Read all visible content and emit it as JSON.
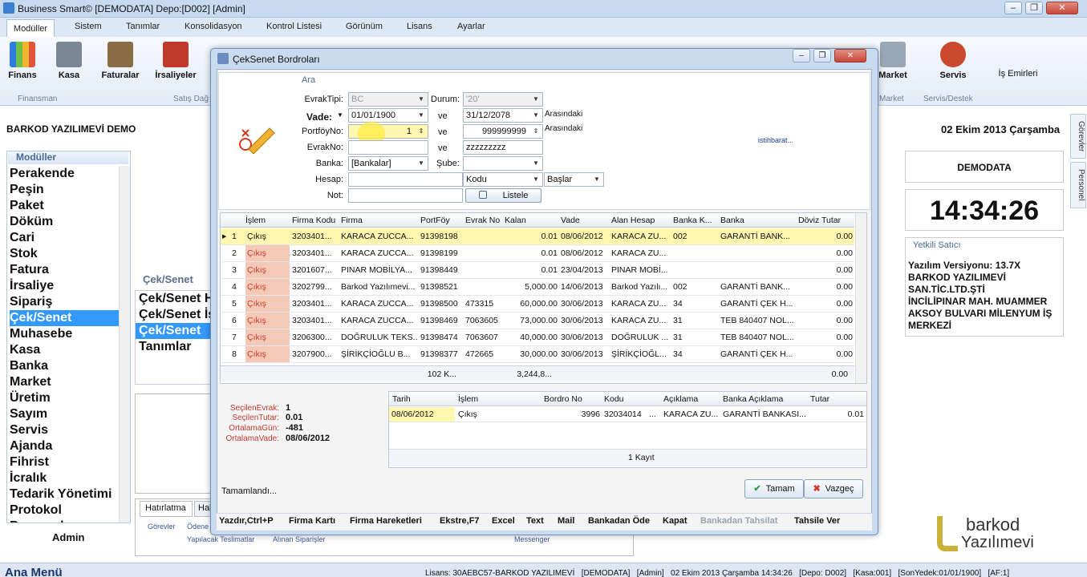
{
  "app": {
    "title": "Business Smart© [DEMODATA] Depo:[D002] [Admin]",
    "window_controls": {
      "minimize": "–",
      "restore": "❐",
      "close": "✕"
    }
  },
  "menu_tabs": [
    "Modüller",
    "Sistem",
    "Tanımlar",
    "Konsolidasyon",
    "Kontrol Listesi",
    "Görünüm",
    "Lisans",
    "Ayarlar"
  ],
  "ribbon": {
    "buttons": [
      {
        "label": "Finans",
        "icon": "finance-chart-icon"
      },
      {
        "label": "Kasa",
        "icon": "cash-register-icon"
      },
      {
        "label": "Faturalar",
        "icon": "invoices-icon"
      },
      {
        "label": "İrsaliyeler",
        "icon": "waybill-icon"
      },
      {
        "label": "Market",
        "icon": "cart-icon"
      },
      {
        "label": "Servis",
        "icon": "service-person-icon"
      },
      {
        "label": "İş Emirleri",
        "icon": "work-order-icon"
      }
    ],
    "groups": [
      "Finansman",
      "Satış Dağ",
      "Market",
      "Servis/Destek"
    ]
  },
  "company": "BARKOD YAZILIMEVİ DEMO",
  "date": "02 Ekim 2013 Çarşamba",
  "modules": {
    "header": "Modüller",
    "items": [
      "Perakende",
      "Peşin",
      "Paket",
      "Döküm",
      "Cari",
      "Stok",
      "Fatura",
      "İrsaliye",
      "Sipariş",
      "Çek/Senet",
      "Muhasebe",
      "Kasa",
      "Banka",
      "Market",
      "Üretim",
      "Sayım",
      "Servis",
      "Ajanda",
      "Fihrist",
      "İcralık",
      "Tedarik Yönetimi",
      "Protokol",
      "Personel"
    ],
    "selected": "Çek/Senet"
  },
  "admin_label": "Admin",
  "cek_panel": {
    "header": "Çek/Senet",
    "items": [
      "Çek/Senet H",
      "Çek/Senet İş",
      "Çek/Senet",
      "Tanımlar"
    ]
  },
  "bottom_tabs": {
    "tab1": "Hatırlatma",
    "tab2": "Hal",
    "sub": [
      "Görevler",
      "Ödene",
      "Yapılacak Teslimatlar",
      "Alınan Siparişler",
      "Messenger"
    ]
  },
  "right_panel": {
    "vtabs": [
      "Görevler",
      "Personel"
    ],
    "demodata": "DEMODATA",
    "clock": "14:34:26",
    "yetkili": "Yetkili Satıcı",
    "info": [
      "Yazılım Versiyonu: 13.7X",
      "BARKOD YAZILIMEVİ",
      "SAN.TİC.LTD.ŞTİ",
      "İNCİLİPINAR MAH. MUAMMER",
      "AKSOY BULVARI MİLENYUM İŞ",
      "MERKEZİ"
    ],
    "logo_text1": "barkod",
    "logo_text2": "Yazılımevi"
  },
  "statusbar": {
    "menu": "Ana Menü",
    "text": "Lisans: 30AEBC57-BARKOD YAZILIMEVİ   [DEMODATA]   [Admin]   02 Ekim 2013 Çarşamba 14:34:26   [Depo: D002]   [Kasa:001]   [SonYedek:01/01/1900]   [AF:1]"
  },
  "modal": {
    "title": "ÇekSenet Bordroları",
    "section": "Ara",
    "fields": {
      "evraktipi_label": "EvrakTipi:",
      "evraktipi_value": "BC",
      "durum_label": "Durum:",
      "durum_value": "'20'",
      "vade_label": "Vade:",
      "vade_from": "01/01/1900",
      "vade_ve": "ve",
      "vade_to": "31/12/2078",
      "vade_suffix": "Arasındaki",
      "portfoy_label": "PortföyNo:",
      "portfoy_from": "1",
      "portfoy_ve": "ve",
      "portfoy_to": "999999999",
      "portfoy_suffix": "Arasındaki",
      "evrakno_label": "EvrakNo:",
      "evrakno_ve": "ve",
      "evrakno_to": "zzzzzzzzz",
      "banka_label": "Banka:",
      "banka_value": "[Bankalar]",
      "sube_label": "Şube:",
      "hesap_label": "Hesap:",
      "hesap_kodu": "Kodu",
      "hesap_baslar": "Başlar",
      "not_label": "Not:",
      "listele": "Listele",
      "istihbarat": "istihbarat..."
    },
    "grid": {
      "headers": [
        "İşlem",
        "Firma Kodu",
        "Firma",
        "PortFöy",
        "Evrak No",
        "Kalan",
        "Vade",
        "Alan Hesap",
        "Banka K...",
        "Banka",
        "Döviz Tutar"
      ],
      "rows": [
        [
          "1",
          "Çıkış",
          "3203401...",
          "KARACA ZUCCA...",
          "91398198",
          "",
          "0.01",
          "08/06/2012",
          "KARACA ZU...",
          "002",
          "GARANTİ BANK...",
          "0.00"
        ],
        [
          "2",
          "Çıkış",
          "3203401...",
          "KARACA ZUCCA...",
          "91398199",
          "",
          "0.01",
          "08/06/2012",
          "KARACA ZU...",
          "",
          "",
          "0.00"
        ],
        [
          "3",
          "Çıkış",
          "3201607...",
          "PINAR MOBİLYA...",
          "91398449",
          "",
          "0.01",
          "23/04/2013",
          "PINAR MOBİ...",
          "",
          "",
          "0.00"
        ],
        [
          "4",
          "Çıkış",
          "3202799...",
          "Barkod Yazılımevi...",
          "91398521",
          "",
          "5,000.00",
          "14/06/2013",
          "Barkod Yazılı...",
          "002",
          "GARANTİ BANK...",
          "0.00"
        ],
        [
          "5",
          "Çıkış",
          "3203401...",
          "KARACA ZUCCA...",
          "91398500",
          "473315",
          "60,000.00",
          "30/06/2013",
          "KARACA ZU...",
          "34",
          "GARANTİ ÇEK H...",
          "0.00"
        ],
        [
          "6",
          "Çıkış",
          "3203401...",
          "KARACA ZUCCA...",
          "91398469",
          "7063605",
          "73,000.00",
          "30/06/2013",
          "KARACA ZU...",
          "31",
          "TEB 840407 NOL...",
          "0.00"
        ],
        [
          "7",
          "Çıkış",
          "3206300...",
          "DOĞRULUK TEKS...",
          "91398474",
          "7063607",
          "40,000.00",
          "30/06/2013",
          "DOĞRULUK ...",
          "31",
          "TEB 840407 NOL...",
          "0.00"
        ],
        [
          "8",
          "Çıkış",
          "3207900...",
          "ŞİRİKÇİOĞLU B...",
          "91398377",
          "472665",
          "30,000.00",
          "30/06/2013",
          "ŞİRİKÇİOĞL...",
          "34",
          "GARANTİ ÇEK H...",
          "0.00"
        ]
      ],
      "footer": {
        "portfoy_sum": "102 K...",
        "kalan_sum": "3,244,8...",
        "doviz_sum": "0.00"
      }
    },
    "summary": {
      "secilen_evrak_label": "SeçilenEvrak:",
      "secilen_evrak": "1",
      "secilen_tutar_label": "SeçilenTutar:",
      "secilen_tutar": "0.01",
      "ortalama_gun_label": "OrtalamaGün:",
      "ortalama_gun": "-481",
      "ortalama_vade_label": "OrtalamaVade:",
      "ortalama_vade": "08/06/2012"
    },
    "detail": {
      "headers": [
        "Tarih",
        "İşlem",
        "Bordro No",
        "Kodu",
        "Açıklama",
        "Banka Açıklama",
        "Tutar"
      ],
      "row": [
        "08/06/2012",
        "Çıkış",
        "3996",
        "32034014",
        "...",
        "KARACA ZU...",
        "GARANTİ BANKASI...",
        "0.01"
      ],
      "footer": "1 Kayıt"
    },
    "status": "Tamamlandı...",
    "ok": "Tamam",
    "cancel": "Vazgeç",
    "shortcuts": [
      "Yazdır,Ctrl+P",
      "Firma Kartı",
      "Firma Hareketleri",
      "Ekstre,F7",
      "Excel",
      "Text",
      "Mail",
      "Bankadan Öde",
      "Kapat",
      "Bankadan Tahsilat",
      "Tahsile Ver"
    ]
  }
}
